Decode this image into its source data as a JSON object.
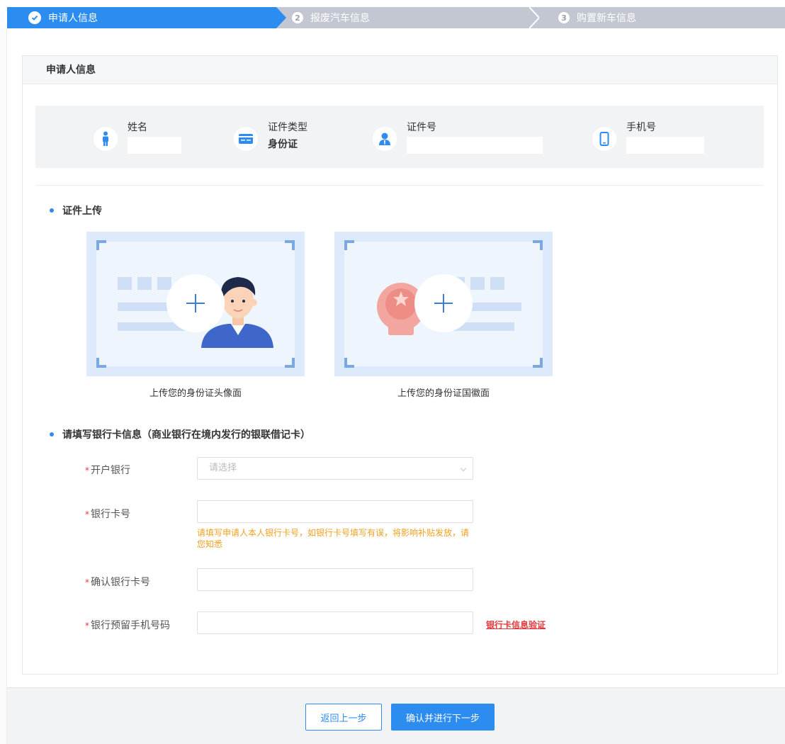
{
  "steps": [
    {
      "label": "申请人信息",
      "state": "active"
    },
    {
      "number": "2",
      "label": "报废汽车信息",
      "state": "pending"
    },
    {
      "number": "3",
      "label": "购置新车信息",
      "state": "pending"
    }
  ],
  "section_header": "申请人信息",
  "applicant": {
    "name_label": "姓名",
    "name_value": "",
    "id_type_label": "证件类型",
    "id_type_value": "身份证",
    "id_number_label": "证件号",
    "id_number_value": "",
    "phone_label": "手机号",
    "phone_value": ""
  },
  "upload_section": {
    "title": "证件上传",
    "front_caption": "上传您的身份证头像面",
    "back_caption": "上传您的身份证国徽面"
  },
  "bank_section": {
    "title": "请填写银行卡信息（商业银行在境内发行的银联借记卡）",
    "bank_label": "开户银行",
    "bank_placeholder": "请选择",
    "card_label": "银行卡号",
    "card_hint": "请填写申请人本人银行卡号，如银行卡号填写有误，将影响补贴发放，请您知悉",
    "confirm_card_label": "确认银行卡号",
    "phone_label": "银行预留手机号码",
    "verify_link": "银行卡信息验证",
    "required_mark": "*"
  },
  "footer": {
    "back_label": "返回上一步",
    "next_label": "确认并进行下一步"
  },
  "colors": {
    "primary": "#2d8cf0",
    "step_pending": "#c2c7d1",
    "hint": "#f0a020",
    "required": "#e4393c"
  }
}
